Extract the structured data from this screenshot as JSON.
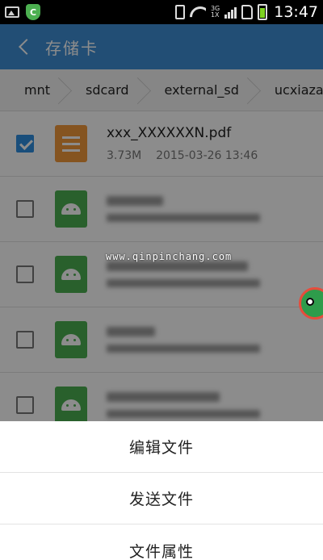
{
  "status_bar": {
    "time": "13:47",
    "network_top": "3G",
    "network_bottom": "1X",
    "icons": [
      "image-icon",
      "shield-icon",
      "phone-icon",
      "wifi-icon",
      "signal-icon",
      "sim-icon",
      "battery-icon"
    ]
  },
  "header": {
    "title": "存储卡",
    "back_icon": "chevron-left-icon",
    "color": "#3f8fd6"
  },
  "breadcrumb": [
    "mnt",
    "sdcard",
    "external_sd",
    "ucxiazai"
  ],
  "files": [
    {
      "name": "xxx_XXXXXXN.pdf",
      "size": "3.73M",
      "date": "2015-03-26 13:46",
      "type": "pdf",
      "checked": true
    },
    {
      "name": "",
      "size": "",
      "date": "",
      "type": "apk",
      "checked": false
    },
    {
      "name": "",
      "size": "",
      "date": "",
      "type": "apk",
      "checked": false
    },
    {
      "name": "",
      "size": "",
      "date": "",
      "type": "apk",
      "checked": false
    },
    {
      "name": "",
      "size": "",
      "date": "",
      "type": "apk",
      "checked": false
    }
  ],
  "watermark": "www.qinpinchang.com",
  "action_sheet": {
    "items": [
      "编辑文件",
      "发送文件",
      "文件属性"
    ]
  },
  "colors": {
    "accent": "#2f8fe0",
    "pdf_icon": "#f39a3b",
    "apk_icon": "#4caf50"
  }
}
